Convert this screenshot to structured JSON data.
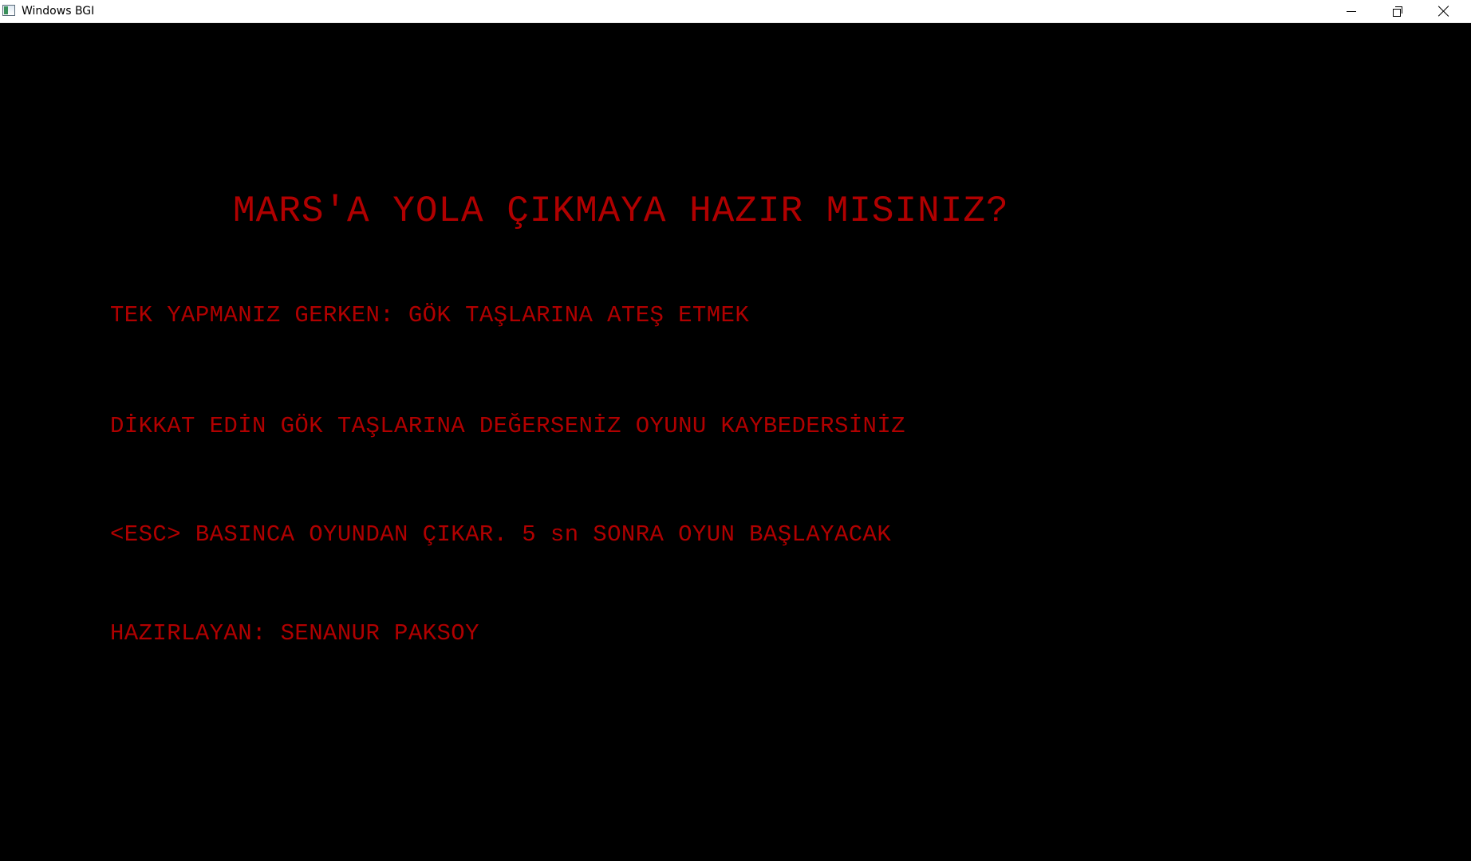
{
  "window": {
    "title": "Windows BGI",
    "app_icon": "bgi-window-icon",
    "controls": {
      "minimize_icon": "minimize-icon",
      "restore_icon": "restore-icon",
      "close_icon": "close-icon"
    }
  },
  "screen": {
    "background_color": "#000000",
    "text_color": "#b00000",
    "headline": "MARS'A YOLA ÇIKMAYA HAZIR MISINIZ?",
    "lines": [
      "TEK YAPMANIZ GERKEN: GÖK TAŞLARINA ATEŞ ETMEK",
      "DİKKAT EDİN GÖK TAŞLARINA DEĞERSENİZ OYUNU KAYBEDERSİNİZ",
      "<ESC> BASINCA OYUNDAN ÇIKAR. 5 sn SONRA OYUN BAŞLAYACAK",
      "HAZIRLAYAN: SENANUR PAKSOY"
    ]
  }
}
